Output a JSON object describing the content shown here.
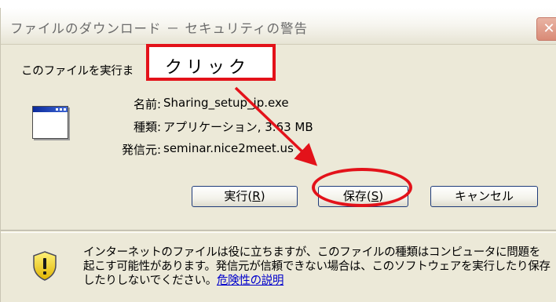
{
  "window": {
    "title": "ファイルのダウンロード － セキュリティの警告",
    "close_symbol": "✕"
  },
  "dialog": {
    "question": "このファイルを実行ま",
    "icon": "application-window-icon",
    "file_info": {
      "name_label": "名前:",
      "name_value": "Sharing_setup_jp.exe",
      "type_label": "種類:",
      "type_value": "アプリケーション, 3.63 MB",
      "from_label": "発信元:",
      "from_value": "seminar.nice2meet.us"
    }
  },
  "buttons": {
    "run_label": "実行(",
    "run_key": "R",
    "save_label": "保存(",
    "save_key": "S",
    "close_paren": ")",
    "cancel_label": "キャンセル"
  },
  "annotation": {
    "callout_text": "クリック",
    "color": "#e3121a"
  },
  "warning": {
    "icon": "security-shield-warning-icon",
    "text": "インターネットのファイルは役に立ちますが、このファイルの種類はコンピュータに問題を起こす可能性があります。発信元が信頼できない場合は、このソフトウェアを実行したり保存したりしないでください。",
    "link": "危険性の説明"
  }
}
